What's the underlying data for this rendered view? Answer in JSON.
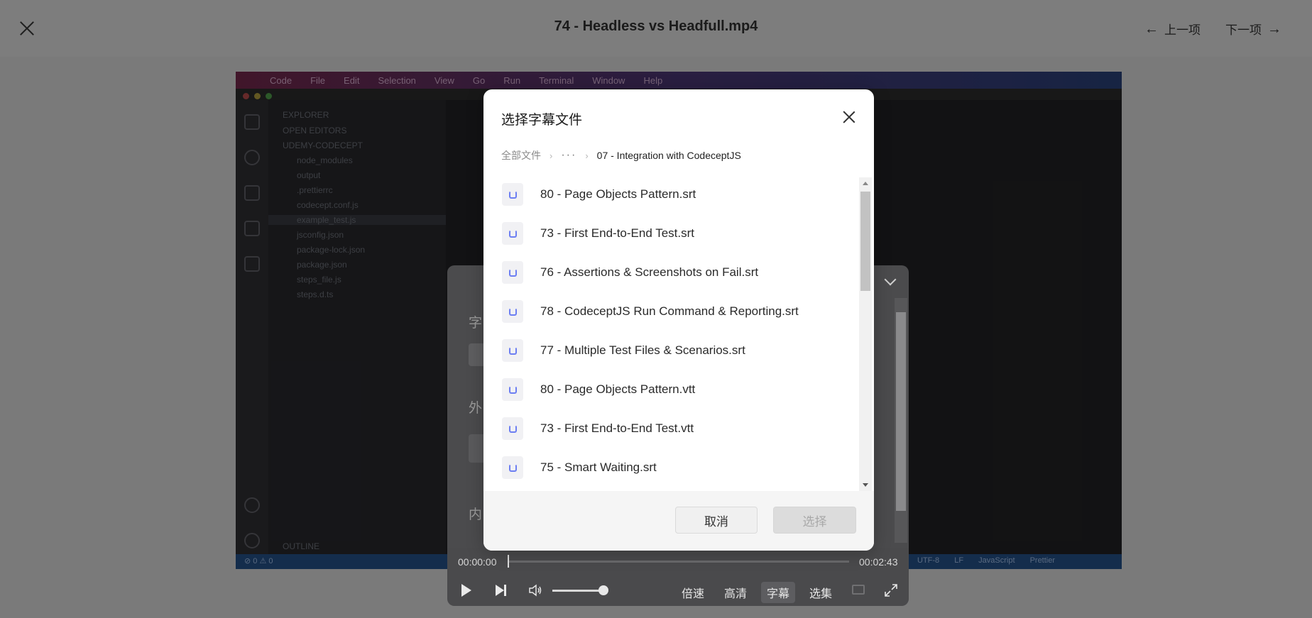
{
  "viewer": {
    "title": "74 - Headless vs Headfull.mp4",
    "prev_label": "上一项",
    "next_label": "下一项"
  },
  "video_frame": {
    "menubar": [
      "Code",
      "File",
      "Edit",
      "Selection",
      "View",
      "Go",
      "Run",
      "Terminal",
      "Window",
      "Help"
    ],
    "explorer": {
      "header": "EXPLORER",
      "open_editors": "OPEN EDITORS",
      "project": "UDEMY-CODECEPT",
      "items": [
        "node_modules",
        "output",
        ".prettierrc",
        "codecept.conf.js",
        "example_test.js",
        "jsconfig.json",
        "package-lock.json",
        "package.json",
        "steps_file.js",
        "steps.d.ts"
      ],
      "outline": "OUTLINE"
    },
    "status_left": "⊘ 0 ⚠ 0",
    "status_right": [
      "UTF-8",
      "LF",
      "JavaScript",
      "Prettier"
    ]
  },
  "subtitle_panel": {
    "label_1": "字",
    "label_2": "外",
    "label_3": "内"
  },
  "player": {
    "current_time": "00:00:00",
    "duration": "00:02:43",
    "speed_label": "倍速",
    "quality_label": "高清",
    "subtitle_label": "字幕",
    "episodes_label": "选集"
  },
  "dialog": {
    "title": "选择字幕文件",
    "breadcrumb": {
      "root": "全部文件",
      "more": "···",
      "current": "07 - Integration with CodeceptJS"
    },
    "files": [
      {
        "name": "80 - Page Objects Pattern.srt"
      },
      {
        "name": "73 - First End-to-End Test.srt"
      },
      {
        "name": "76 - Assertions & Screenshots on Fail.srt"
      },
      {
        "name": "78 - CodeceptJS Run Command & Reporting.srt"
      },
      {
        "name": "77 - Multiple Test Files & Scenarios.srt"
      },
      {
        "name": "80 - Page Objects Pattern.vtt"
      },
      {
        "name": "73 - First End-to-End Test.vtt"
      },
      {
        "name": "75 - Smart Waiting.srt"
      }
    ],
    "cancel_label": "取消",
    "select_label": "选择"
  }
}
